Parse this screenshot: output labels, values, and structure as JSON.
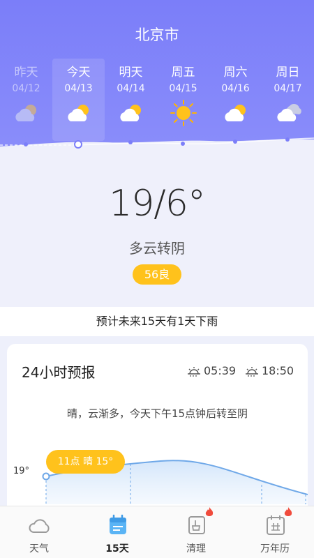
{
  "header": {
    "city": "北京市"
  },
  "days": [
    {
      "name": "昨天",
      "date": "04/12",
      "icon": "partly-cloudy-icon",
      "state": "past"
    },
    {
      "name": "今天",
      "date": "04/13",
      "icon": "partly-cloudy-icon",
      "state": "selected"
    },
    {
      "name": "明天",
      "date": "04/14",
      "icon": "partly-cloudy-icon",
      "state": "normal"
    },
    {
      "name": "周五",
      "date": "04/15",
      "icon": "sunny-icon",
      "state": "normal"
    },
    {
      "name": "周六",
      "date": "04/16",
      "icon": "partly-cloudy-icon",
      "state": "normal"
    },
    {
      "name": "周日",
      "date": "04/17",
      "icon": "cloudy-icon",
      "state": "normal"
    }
  ],
  "current": {
    "temp": "19/6°",
    "condition": "多云转阴",
    "aqi": "56良"
  },
  "forecast_note": "预计未来15天有1天下雨",
  "hourly": {
    "title": "24小时预报",
    "sunrise": "05:39",
    "sunset": "18:50",
    "description": "晴，云渐多，今天下午15点钟后转至阴",
    "y_label": "19°",
    "bubble": "11点 晴 15°"
  },
  "tabs": [
    {
      "label": "天气",
      "icon": "cloud-icon",
      "active": false
    },
    {
      "label": "15天",
      "icon": "calendar-icon",
      "active": true
    },
    {
      "label": "清理",
      "icon": "broom-icon",
      "active": false
    },
    {
      "label": "万年历",
      "icon": "almanac-icon",
      "active": false
    }
  ],
  "colors": {
    "header": "#7b7ef9",
    "accent": "#ffc21c",
    "tab_active": "#5ab4f5"
  }
}
